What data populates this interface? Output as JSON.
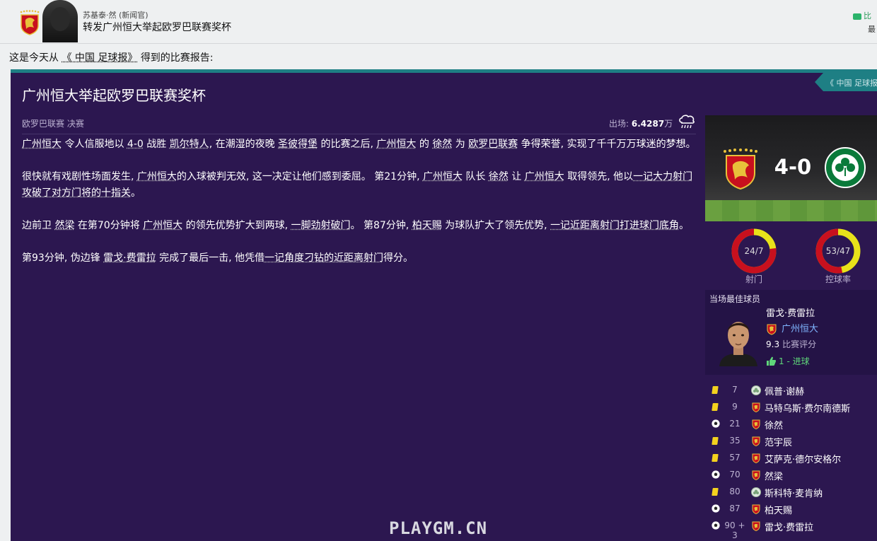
{
  "header": {
    "sender": "苏基泰·然 (新闻官)",
    "subject": "转发广州恒大举起欧罗巴联赛奖杯",
    "right_tag": "比",
    "right_sub": "最"
  },
  "intro": {
    "prefix": "这是今天从",
    "publication": "《 中国 足球报》",
    "suffix": "得到的比赛报告:"
  },
  "panel": {
    "ribbon": "《 中国 足球报",
    "headline": "广州恒大举起欧罗巴联赛奖杯",
    "competition": "欧罗巴联赛 决赛",
    "attendance_label": "出场:",
    "attendance_value": "6.4287",
    "attendance_unit": "万",
    "weather_icon": "rain-cloud-icon"
  },
  "article": [
    [
      {
        "t": "广州恒大",
        "l": true
      },
      {
        "t": " 令人信服地以 "
      },
      {
        "t": "4-0",
        "l": true
      },
      {
        "t": " 战胜 "
      },
      {
        "t": "凯尔特人",
        "l": true
      },
      {
        "t": ", 在潮湿的夜晚 "
      },
      {
        "t": "圣彼得堡",
        "l": true
      },
      {
        "t": " 的比赛之后, "
      },
      {
        "t": "广州恒大",
        "l": true
      },
      {
        "t": " 的 "
      },
      {
        "t": "徐然",
        "l": true
      },
      {
        "t": " 为 "
      },
      {
        "t": "欧罗巴联赛",
        "l": true
      },
      {
        "t": " 争得荣誉, 实现了千千万万球迷的梦想。"
      }
    ],
    [
      {
        "t": "很快就有戏剧性场面发生, "
      },
      {
        "t": "广州恒大",
        "l": true
      },
      {
        "t": "的入球被判无效, 这一决定让他们感到委屈。 第21分钟, "
      },
      {
        "t": "广州恒大",
        "l": true
      },
      {
        "t": " 队长 "
      },
      {
        "t": "徐然",
        "l": true
      },
      {
        "t": " 让 "
      },
      {
        "t": "广州恒大",
        "l": true
      },
      {
        "t": " 取得领先, 他以"
      },
      {
        "t": "一记大力射门攻破了对方门将的十指关",
        "l": true
      },
      {
        "t": "。"
      }
    ],
    [
      {
        "t": "边前卫 "
      },
      {
        "t": "然梁",
        "l": true
      },
      {
        "t": " 在第70分钟将 "
      },
      {
        "t": "广州恒大",
        "l": true
      },
      {
        "t": " 的领先优势扩大到两球, "
      },
      {
        "t": "一脚劲射破门",
        "l": true
      },
      {
        "t": "。 第87分钟, "
      },
      {
        "t": "柏天赐",
        "l": true
      },
      {
        "t": " 为球队扩大了领先优势, "
      },
      {
        "t": "一记近距离射门打进球门底角",
        "l": true
      },
      {
        "t": "。"
      }
    ],
    [
      {
        "t": "第93分钟, 伪边锋 "
      },
      {
        "t": "雷戈·费雷拉",
        "l": true
      },
      {
        "t": " 完成了最后一击, 他凭借"
      },
      {
        "t": "一记角度刁钻的近距离射门",
        "l": true
      },
      {
        "t": "得分。"
      }
    ]
  ],
  "scoreboard": {
    "score": "4-0",
    "home_badge": "guangzhou-evergrande-badge",
    "away_badge": "celtic-badge"
  },
  "stats": [
    {
      "value": "24/7",
      "label": "射门",
      "home_fraction": 0.77
    },
    {
      "value": "53/47",
      "label": "控球率",
      "home_fraction": 0.53
    }
  ],
  "colors": {
    "home": "#c8101e",
    "away": "#e8e21a",
    "panel_bg": "#2c1750",
    "accent": "#1e7f84"
  },
  "best_player": {
    "title": "当场最佳球员",
    "name": "雷戈·费雷拉",
    "club": "广州恒大",
    "rating": "9.3",
    "rating_label": "比赛评分",
    "goals": "1 - 进球"
  },
  "events": [
    {
      "type": "yellow-card",
      "minute": "7",
      "club": "celtic",
      "player": "佩普·谢赫"
    },
    {
      "type": "yellow-card",
      "minute": "9",
      "club": "guangzhou",
      "player": "马特乌斯·费尔南德斯"
    },
    {
      "type": "goal",
      "minute": "21",
      "club": "guangzhou",
      "player": "徐然"
    },
    {
      "type": "yellow-card",
      "minute": "35",
      "club": "guangzhou",
      "player": "范宇辰"
    },
    {
      "type": "yellow-card",
      "minute": "57",
      "club": "guangzhou",
      "player": "艾萨克·德尔安格尔"
    },
    {
      "type": "goal",
      "minute": "70",
      "club": "guangzhou",
      "player": "然梁"
    },
    {
      "type": "yellow-card",
      "minute": "80",
      "club": "celtic",
      "player": "斯科特·麦肯纳"
    },
    {
      "type": "goal",
      "minute": "87",
      "club": "guangzhou",
      "player": "柏天赐"
    },
    {
      "type": "goal",
      "minute": "90 + 3",
      "club": "guangzhou",
      "player": "雷戈·费雷拉"
    }
  ],
  "watermark": "PLAYGM.CN"
}
